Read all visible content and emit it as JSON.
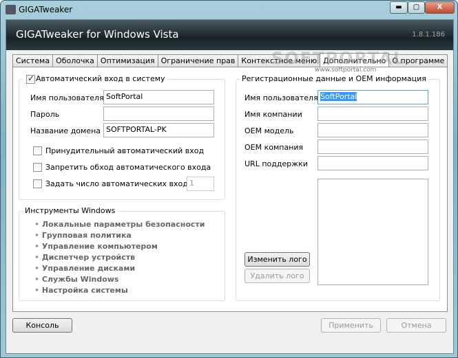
{
  "window": {
    "title": "GIGATweaker",
    "minimize": "▬",
    "maximize": "▢",
    "close": "X"
  },
  "banner": {
    "title": "GIGATweaker for Windows Vista",
    "version": "1.8.1.186"
  },
  "tabs": [
    {
      "label": "Система"
    },
    {
      "label": "Оболочка"
    },
    {
      "label": "Оптимизация"
    },
    {
      "label": "Ограничение прав"
    },
    {
      "label": "Контекстное меню"
    },
    {
      "label": "Дополнительно",
      "selected": true
    },
    {
      "label": "О программе"
    }
  ],
  "autologon": {
    "title": "Автоматический вход в систему",
    "checked": true,
    "user_label": "Имя пользователя",
    "user_value": "SoftPortal",
    "password_label": "Пароль",
    "password_value": "",
    "domain_label": "Название домена",
    "domain_value": "SOFTPORTAL-PK",
    "force_label": "Принудительный автоматический вход",
    "force_checked": false,
    "prevent_label": "Запретить обход автоматического входа",
    "prevent_checked": false,
    "count_label": "Задать число автоматических входов:",
    "count_checked": false,
    "count_value": "1"
  },
  "tools": {
    "title": "Инструменты Windows",
    "items": [
      "Локальные параметры безопасности",
      "Групповая политика",
      "Управление компьютером",
      "Диспетчер устройств",
      "Управление дисками",
      "Службы Windows",
      "Настройка системы"
    ]
  },
  "oem": {
    "title": "Регистрационные данные и OEM информация",
    "fields": [
      {
        "label": "Имя пользователя",
        "value": "SoftPortal"
      },
      {
        "label": "Имя компании",
        "value": ""
      },
      {
        "label": "OEM модель",
        "value": ""
      },
      {
        "label": "OEM компания",
        "value": ""
      },
      {
        "label": "URL поддержки",
        "value": ""
      }
    ],
    "change_logo": "Изменить лого",
    "delete_logo": "Удалить лого"
  },
  "footer": {
    "console": "Консоль",
    "apply": "Применить",
    "cancel": "Отмена"
  },
  "watermark": {
    "logo": "SOFTPORTAL",
    "url": "www.softportal.com"
  }
}
